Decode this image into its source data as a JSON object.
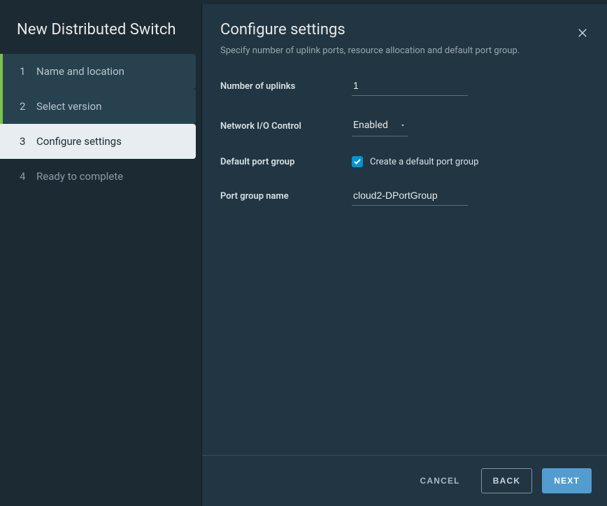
{
  "sidebar": {
    "title": "New Distributed Switch",
    "steps": [
      {
        "num": "1",
        "label": "Name and location"
      },
      {
        "num": "2",
        "label": "Select version"
      },
      {
        "num": "3",
        "label": "Configure settings"
      },
      {
        "num": "4",
        "label": "Ready to complete"
      }
    ]
  },
  "header": {
    "title": "Configure settings",
    "subtitle": "Specify number of uplink ports, resource allocation and default port group."
  },
  "form": {
    "uplinks_label": "Number of uplinks",
    "uplinks_value": "1",
    "nioc_label": "Network I/O Control",
    "nioc_value": "Enabled",
    "default_pg_label": "Default port group",
    "default_pg_checkbox_label": "Create a default port group",
    "pg_name_label": "Port group name",
    "pg_name_value": "cloud2-DPortGroup"
  },
  "footer": {
    "cancel": "CANCEL",
    "back": "BACK",
    "next": "NEXT"
  }
}
